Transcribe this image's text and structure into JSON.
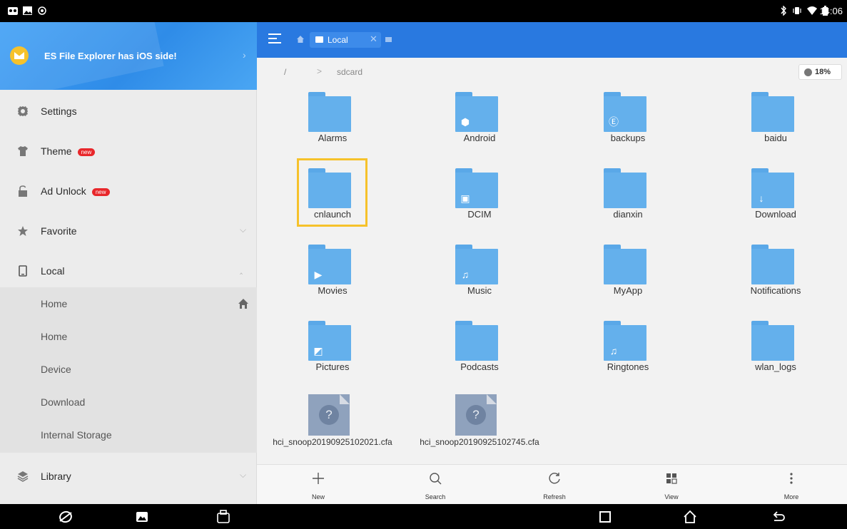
{
  "status": {
    "time": "14:06"
  },
  "promo": {
    "text": "ES File Explorer has iOS side!"
  },
  "sidebar": {
    "items": [
      {
        "label": "Settings"
      },
      {
        "label": "Theme",
        "badge": "new"
      },
      {
        "label": "Ad Unlock",
        "badge": "new"
      },
      {
        "label": "Favorite"
      },
      {
        "label": "Local"
      },
      {
        "label": "Library"
      }
    ],
    "local_sub": [
      "Home",
      "Home",
      "Device",
      "Download",
      "Internal Storage"
    ]
  },
  "toolbar": {
    "tab_label": "Local"
  },
  "path": {
    "root": "/",
    "sep": ">",
    "current": "sdcard",
    "storage": "18%"
  },
  "files": [
    {
      "name": "Alarms",
      "kind": "folder",
      "badge": ""
    },
    {
      "name": "Android",
      "kind": "folder",
      "badge": "gear"
    },
    {
      "name": "backups",
      "kind": "folder",
      "badge": "es"
    },
    {
      "name": "baidu",
      "kind": "folder",
      "badge": ""
    },
    {
      "name": "cnlaunch",
      "kind": "folder",
      "badge": ""
    },
    {
      "name": "DCIM",
      "kind": "folder",
      "badge": "camera"
    },
    {
      "name": "dianxin",
      "kind": "folder",
      "badge": ""
    },
    {
      "name": "Download",
      "kind": "folder",
      "badge": "download"
    },
    {
      "name": "Movies",
      "kind": "folder",
      "badge": "play"
    },
    {
      "name": "Music",
      "kind": "folder",
      "badge": "music"
    },
    {
      "name": "MyApp",
      "kind": "folder",
      "badge": ""
    },
    {
      "name": "Notifications",
      "kind": "folder",
      "badge": ""
    },
    {
      "name": "Pictures",
      "kind": "folder",
      "badge": "picture"
    },
    {
      "name": "Podcasts",
      "kind": "folder",
      "badge": ""
    },
    {
      "name": "Ringtones",
      "kind": "folder",
      "badge": "music"
    },
    {
      "name": "wlan_logs",
      "kind": "folder",
      "badge": ""
    },
    {
      "name": "hci_snoop20190925102021.cfa",
      "kind": "unknown"
    },
    {
      "name": "hci_snoop20190925102745.cfa",
      "kind": "unknown"
    }
  ],
  "actions": [
    "New",
    "Search",
    "Refresh",
    "View",
    "More"
  ]
}
